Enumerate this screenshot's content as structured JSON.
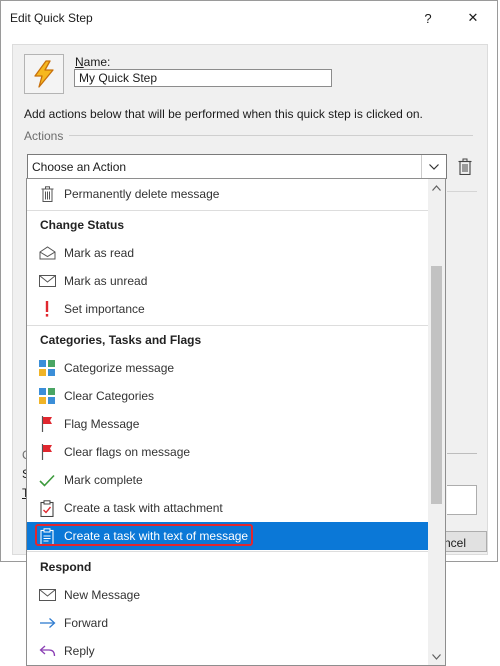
{
  "window": {
    "title": "Edit Quick Step",
    "help_label": "?",
    "close_label": "✕"
  },
  "form": {
    "name_label_underlined": "N",
    "name_label_rest": "ame:",
    "name_value": "My Quick Step",
    "instructions": "Add actions below that will be performed when this quick step is clicked on.",
    "actions_label": "Actions",
    "combo_value": "Choose an Action",
    "cancel_label": "Cancel",
    "peek_c": "C",
    "peek_s": "S",
    "peek_t": "T"
  },
  "dropdown": {
    "rows": [
      {
        "label": "Permanently delete message",
        "icon": "trash-icon"
      },
      {
        "label": "Change Status",
        "header": true
      },
      {
        "label": "Mark as read",
        "icon": "envelope-open-icon"
      },
      {
        "label": "Mark as unread",
        "icon": "envelope-icon"
      },
      {
        "label": "Set importance",
        "icon": "exclamation-icon"
      },
      {
        "label": "Categories, Tasks and Flags",
        "header": true
      },
      {
        "label": "Categorize message",
        "icon": "category-grid-icon"
      },
      {
        "label": "Clear Categories",
        "icon": "category-grid-icon"
      },
      {
        "label": "Flag Message",
        "icon": "red-flag-icon"
      },
      {
        "label": "Clear flags on message",
        "icon": "red-flag-icon"
      },
      {
        "label": "Mark complete",
        "icon": "checkmark-icon"
      },
      {
        "label": "Create a task with attachment",
        "icon": "clipboard-check-icon"
      },
      {
        "label": "Create a task with text of message",
        "icon": "clipboard-icon",
        "selected": true
      },
      {
        "label": "Respond",
        "header": true
      },
      {
        "label": "New Message",
        "icon": "envelope-icon"
      },
      {
        "label": "Forward",
        "icon": "arrow-right-icon"
      },
      {
        "label": "Reply",
        "icon": "reply-icon"
      }
    ]
  },
  "colors": {
    "selection": "#0b78d7",
    "highlight_outline": "#e0272f",
    "flag_red": "#e0272f",
    "check_green": "#3c9a3c"
  }
}
